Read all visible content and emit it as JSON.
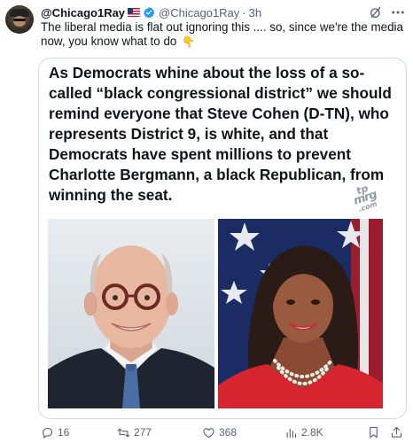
{
  "post": {
    "display_name": "@Chicago1Ray",
    "handle": "@Chicago1Ray",
    "separator": "·",
    "time": "3h",
    "flag_icon": "us-flag-icon",
    "verified_icon": "verified-badge-icon",
    "text": "The liberal media is flat out ignoring this .... so, since we're the media now, you know what to do",
    "emoji": "👇"
  },
  "card": {
    "headline": "As Democrats whine about the loss of a so-called “black congressional district” we should remind everyone that Steve Cohen (D-TN), who represents District 9, is white, and that Democrats have spent millions to prevent Charlotte Bergmann, a black Republican, from winning the seat.",
    "watermark": [
      "tp",
      "mrg",
      ".com"
    ]
  },
  "actions": {
    "replies": "16",
    "reposts": "277",
    "likes": "368",
    "views": "2.8K"
  },
  "colors": {
    "text": "#0f1419",
    "muted": "#536471",
    "verified": "#1d9bf0",
    "border": "#cfd9de"
  }
}
